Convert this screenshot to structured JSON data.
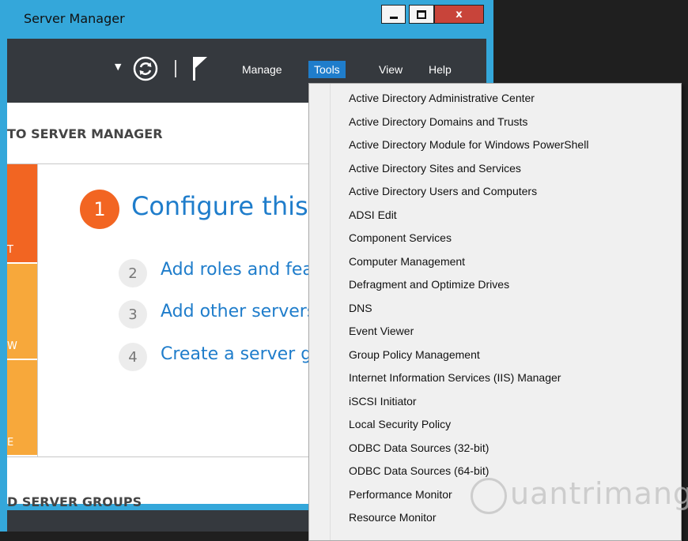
{
  "window": {
    "title": "Server Manager",
    "close_label": "x"
  },
  "toolbar": {
    "menu": [
      "Manage",
      "Tools",
      "View",
      "Help"
    ],
    "active_menu": "Tools",
    "accent": "#1f7dcb"
  },
  "dashboard": {
    "welcome_heading": "TO SERVER MANAGER",
    "tiles": [
      {
        "label": "T",
        "color": "#f26522"
      },
      {
        "label": "W",
        "color": "#f7a83b"
      },
      {
        "label": "E",
        "color": "#f7a83b"
      }
    ],
    "steps": [
      {
        "number": "1",
        "text": "Configure this loc"
      },
      {
        "number": "2",
        "text": "Add roles and feat"
      },
      {
        "number": "3",
        "text": "Add other servers"
      },
      {
        "number": "4",
        "text": "Create a server gr"
      }
    ],
    "server_groups_heading": "D SERVER GROUPS"
  },
  "tools_menu": {
    "items": [
      "Active Directory Administrative Center",
      "Active Directory Domains and Trusts",
      "Active Directory Module for Windows PowerShell",
      "Active Directory Sites and Services",
      "Active Directory Users and Computers",
      "ADSI Edit",
      "Component Services",
      "Computer Management",
      "Defragment and Optimize Drives",
      "DNS",
      "Event Viewer",
      "Group Policy Management",
      "Internet Information Services (IIS) Manager",
      "iSCSI Initiator",
      "Local Security Policy",
      "ODBC Data Sources (32-bit)",
      "ODBC Data Sources (64-bit)",
      "Performance Monitor",
      "Resource Monitor"
    ]
  },
  "watermark": {
    "text": "uantrimang"
  }
}
